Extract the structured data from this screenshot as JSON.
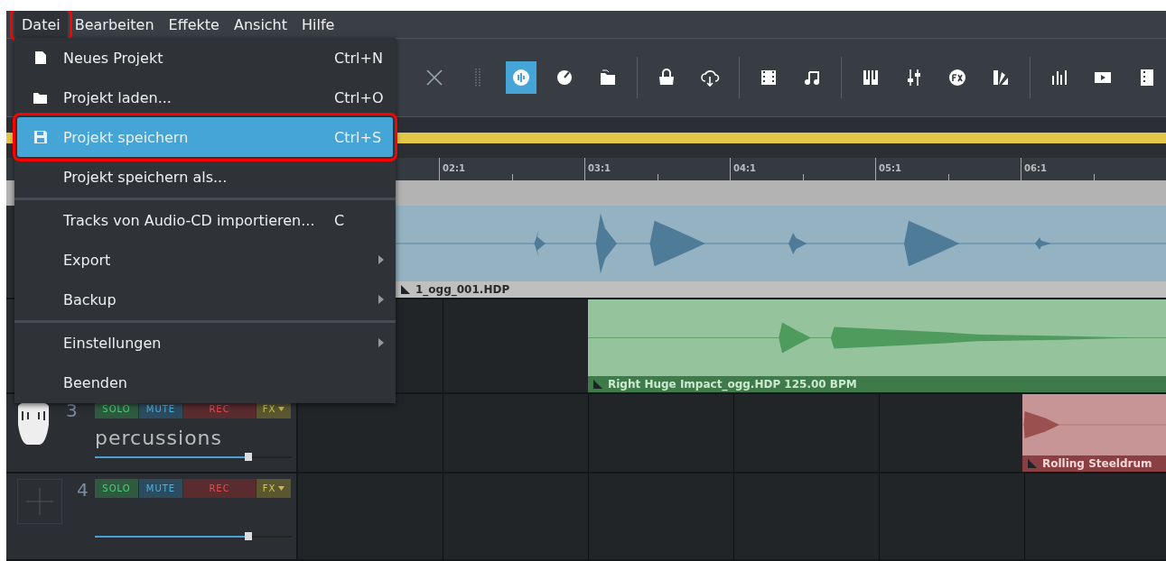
{
  "menu_bar": [
    {
      "label": "Datei",
      "selected": true,
      "annotated": true
    },
    {
      "label": "Bearbeiten",
      "selected": false,
      "annotated": false
    },
    {
      "label": "Effekte",
      "selected": false,
      "annotated": false
    },
    {
      "label": "Ansicht",
      "selected": false,
      "annotated": false
    },
    {
      "label": "Hilfe",
      "selected": false,
      "annotated": false
    }
  ],
  "file_menu": [
    {
      "kind": "item",
      "label": "Neues Projekt",
      "shortcut": "Ctrl+N",
      "submenu": false,
      "selected": false,
      "annotated": false
    },
    {
      "kind": "item",
      "label": "Projekt laden...",
      "shortcut": "Ctrl+O",
      "submenu": false,
      "selected": false,
      "annotated": false
    },
    {
      "kind": "item",
      "label": "Projekt speichern",
      "shortcut": "Ctrl+S",
      "submenu": false,
      "selected": true,
      "annotated": true
    },
    {
      "kind": "item",
      "label": "Projekt speichern als...",
      "submenu": false,
      "selected": false,
      "annotated": false
    },
    {
      "kind": "separator"
    },
    {
      "kind": "item",
      "label": "Tracks von Audio-CD importieren...",
      "shortcut": "C",
      "submenu": false,
      "selected": false,
      "annotated": false
    },
    {
      "kind": "item",
      "label": "Export",
      "submenu": true,
      "selected": false,
      "annotated": false
    },
    {
      "kind": "item",
      "label": "Backup",
      "submenu": true,
      "selected": false,
      "annotated": false
    },
    {
      "kind": "separator"
    },
    {
      "kind": "item",
      "label": "Einstellungen",
      "submenu": true,
      "selected": false,
      "annotated": false
    },
    {
      "kind": "item",
      "label": "Beenden",
      "submenu": false,
      "selected": false,
      "annotated": false
    }
  ],
  "toolbar_groups": [
    [
      {
        "kind": "close",
        "selected": false
      },
      {
        "kind": "grip",
        "selected": false
      },
      {
        "kind": "waveform",
        "selected": true
      },
      {
        "kind": "knob",
        "selected": false
      },
      {
        "kind": "folders",
        "selected": false
      }
    ],
    [
      {
        "kind": "bag",
        "selected": false
      },
      {
        "kind": "cloud",
        "selected": false
      }
    ],
    [
      {
        "kind": "film",
        "selected": false
      },
      {
        "kind": "note",
        "selected": false
      }
    ],
    [
      {
        "kind": "piano",
        "selected": false
      },
      {
        "kind": "mixer",
        "selected": false
      },
      {
        "kind": "fx",
        "selected": false
      },
      {
        "kind": "fan",
        "selected": false
      }
    ],
    [
      {
        "kind": "bars",
        "selected": false
      },
      {
        "kind": "play",
        "selected": false
      },
      {
        "kind": "strip",
        "selected": false
      }
    ]
  ],
  "ruler": [
    "02:1",
    "03:1",
    "04:1",
    "05:1",
    "06:1"
  ],
  "tracks": [
    {
      "clip": {
        "kind": "blue",
        "label": "1_ogg_001.HDP"
      }
    },
    {
      "clip": {
        "kind": "green",
        "label": "Right Huge Impact_ogg.HDP  125.00 BPM"
      }
    },
    {
      "number": "3",
      "name": "percussions",
      "level": 0.78,
      "buttons": [
        {
          "kind": "solo",
          "label": "SOLO"
        },
        {
          "kind": "mute",
          "label": "MUTE"
        },
        {
          "kind": "rec",
          "label": "REC"
        },
        {
          "kind": "fx",
          "label": "FX"
        }
      ],
      "clip": {
        "kind": "red",
        "label": "Rolling Steeldrum"
      }
    },
    {
      "number": "4",
      "level": 0.78,
      "buttons": [
        {
          "kind": "solo",
          "label": "SOLO"
        },
        {
          "kind": "mute",
          "label": "MUTE"
        },
        {
          "kind": "rec",
          "label": "REC"
        },
        {
          "kind": "fx",
          "label": "FX"
        }
      ]
    }
  ]
}
